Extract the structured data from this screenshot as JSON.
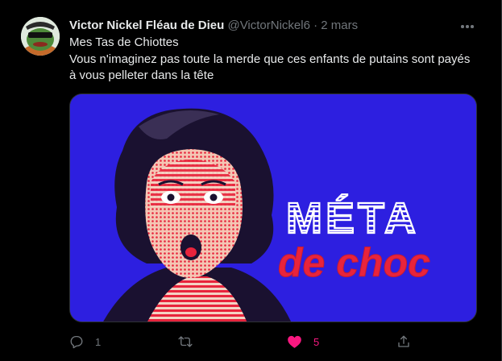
{
  "author": {
    "display_name": "Victor Nickel Fléau de Dieu",
    "handle": "@VictorNickel6",
    "separator": "·",
    "date": "2 mars"
  },
  "tweet": {
    "text_lines": [
      "Mes Tas de Chiottes",
      "Vous n'imaginez pas toute la merde que ces enfants de putains sont payés",
      "à vous pelleter dans la tête"
    ]
  },
  "media": {
    "title_line_1": "MÉTA",
    "title_line_2": "de choc",
    "background_color": "#2d1fe0",
    "accent_color": "#e8243c",
    "stripe_color": "#ffffff"
  },
  "actions": {
    "reply_count": "1",
    "retweet_count": "",
    "like_count": "5",
    "liked": true
  },
  "colors": {
    "background": "#000000",
    "text": "#e7e9ea",
    "muted": "#71767b",
    "like": "#f91880"
  }
}
